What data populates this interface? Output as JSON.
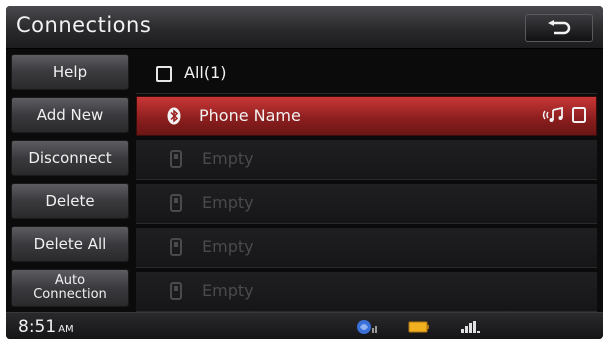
{
  "header": {
    "title": "Connections"
  },
  "sidebar": {
    "items": [
      {
        "label": "Help"
      },
      {
        "label": "Add New"
      },
      {
        "label": "Disconnect"
      },
      {
        "label": "Delete"
      },
      {
        "label": "Delete All"
      },
      {
        "label": "Auto\nConnection"
      }
    ]
  },
  "list": {
    "header_label": "All(1)",
    "rows": [
      {
        "label": "Phone Name",
        "selected": true
      },
      {
        "label": "Empty"
      },
      {
        "label": "Empty"
      },
      {
        "label": "Empty"
      },
      {
        "label": "Empty"
      }
    ]
  },
  "status": {
    "time": "8:51",
    "ampm": "AM"
  },
  "colors": {
    "selected_row": "#b42d2d",
    "background": "#0b0b0c",
    "battery": "#f0b020"
  },
  "icons": [
    "back-icon",
    "bluetooth-icon",
    "phone-icon",
    "streaming-audio-icon",
    "phone-device-icon",
    "navigation-icon",
    "battery-icon",
    "signal-icon"
  ]
}
